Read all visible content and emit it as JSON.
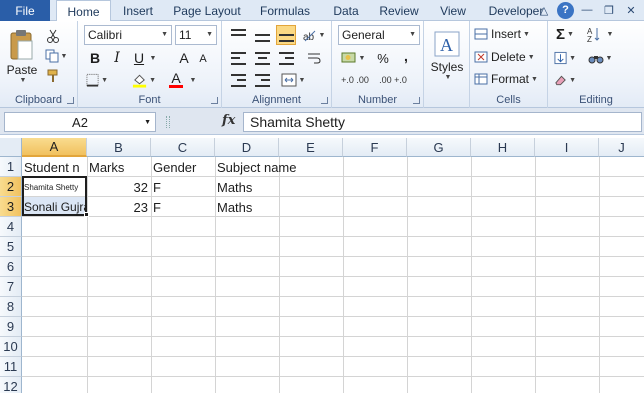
{
  "tabs": {
    "file": "File",
    "items": [
      "Home",
      "Insert",
      "Page Layout",
      "Formulas",
      "Data",
      "Review",
      "View",
      "Developer"
    ],
    "active": "Home"
  },
  "ribbon": {
    "clipboard": {
      "label": "Clipboard",
      "paste": "Paste"
    },
    "font": {
      "label": "Font",
      "name": "Calibri",
      "size": "11",
      "bold": "B",
      "italic": "I",
      "underline": "U",
      "grow": "A",
      "shrink": "A",
      "fill_color": "#ffff00",
      "font_color": "#ff0000",
      "font_color_letter": "A"
    },
    "alignment": {
      "label": "Alignment"
    },
    "number": {
      "label": "Number",
      "format": "General",
      "percent": "%",
      "comma": ",",
      "inc_decimal": "+.0 .00",
      "dec_decimal": ".00 +.0"
    },
    "styles": {
      "label": "Styles"
    },
    "cells": {
      "label": "Cells",
      "insert": "Insert",
      "delete": "Delete",
      "format": "Format"
    },
    "editing": {
      "label": "Editing",
      "sum": "Σ"
    }
  },
  "formula_bar": {
    "name_box": "A2",
    "fx": "fx",
    "content": "Shamita Shetty"
  },
  "grid": {
    "columns": [
      "A",
      "B",
      "C",
      "D",
      "E",
      "F",
      "G",
      "H",
      "I",
      "J"
    ],
    "rows": [
      "1",
      "2",
      "3",
      "4",
      "5",
      "6",
      "7",
      "8",
      "9",
      "10",
      "11",
      "12"
    ],
    "selected_column": "A",
    "selected_rows": [
      "2",
      "3"
    ],
    "cells": {
      "A1": "Student n",
      "B1": "Marks",
      "C1": "Gender",
      "D1": "Subject name",
      "A2": "Shamita Shetty",
      "B2": "32",
      "C2": "F",
      "D2": "Maths",
      "A3": "Sonali Gujral",
      "B3": "23",
      "C3": "F",
      "D3": "Maths"
    }
  }
}
